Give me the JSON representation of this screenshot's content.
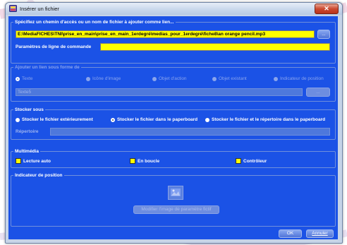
{
  "window": {
    "title": "Insérer un fichier",
    "close_glyph": "✕"
  },
  "path_group": {
    "legend": "Spécifiez un chemin d'accès ou un nom de fichier à ajouter comme lien...",
    "path_value": "E:\\MediaFICHES\\TNI\\prise_en_main\\prise_en_main_1erdegré\\medias_pour_1erdegré\\fiche8\\an orange pencil.mp3",
    "browse_label": "...",
    "params_label": "Paramètres de ligne de commande",
    "params_value": ""
  },
  "link_group": {
    "legend": "Ajouter un lien sous forme de",
    "options": [
      "Texte",
      "Icône d'image",
      "Objet d'action",
      "Objet existant",
      "Indicateur de position"
    ],
    "selected": 0,
    "text_value": "Texte5",
    "browse_label": "..."
  },
  "store_group": {
    "legend": "Stocker sous",
    "options": [
      "Stocker le fichier extérieurement",
      "Stocker le fichier dans le paperboard",
      "Stocker le fichier et le répertoire dans le paperboard"
    ],
    "selected": 1,
    "dir_label": "Répertoire",
    "dir_value": ""
  },
  "multimedia_group": {
    "legend": "Multimédia",
    "options": [
      "Lecture auto",
      "En boucle",
      "Contrôleur"
    ]
  },
  "position_group": {
    "legend": "Indicateur de position",
    "modify_label": "Modifier l'image de paramètre fictif"
  },
  "footer": {
    "ok_label": "OK",
    "cancel_label": "Annuler"
  },
  "colors": {
    "dialog_blue": "#1b52e6",
    "field_yellow": "#ffff00"
  }
}
